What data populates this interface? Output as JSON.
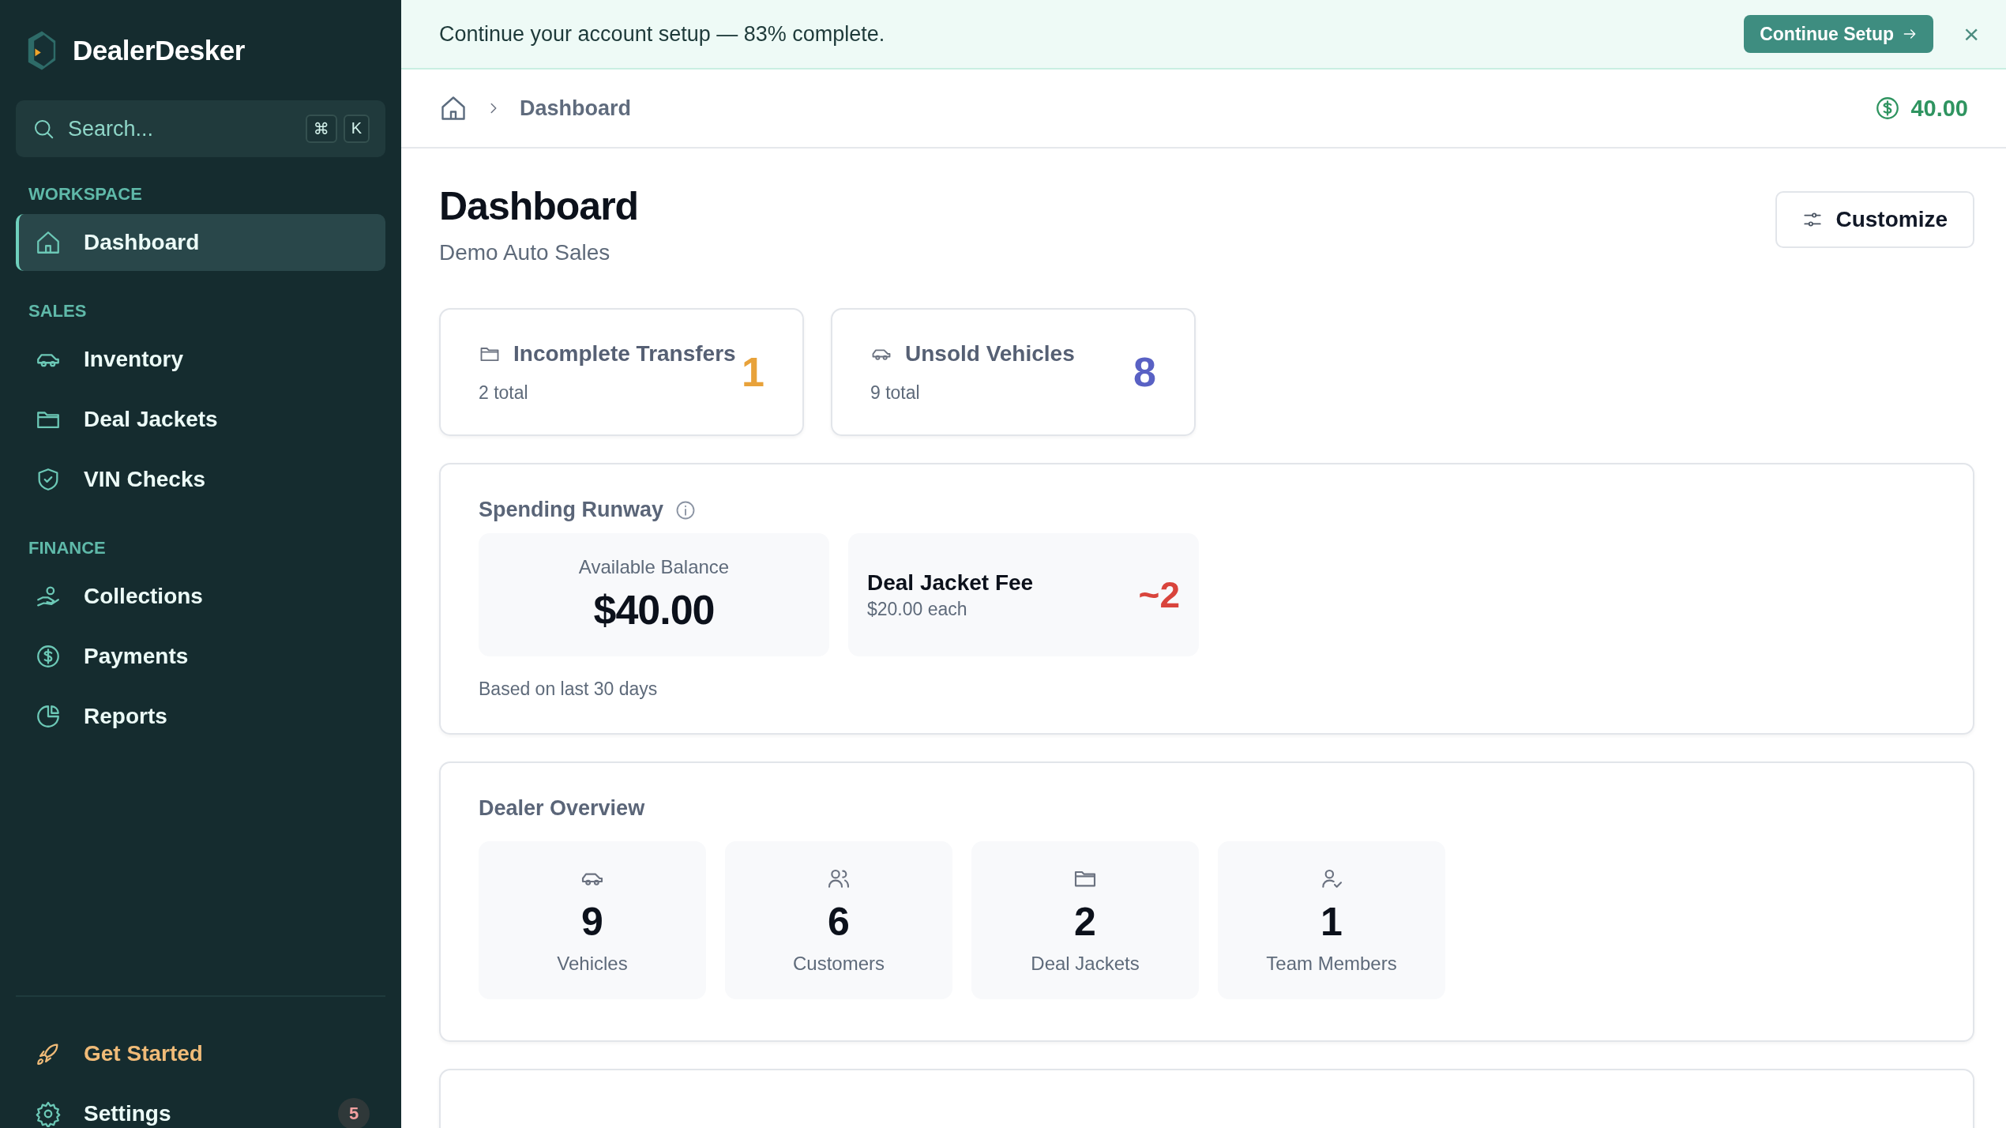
{
  "brand": {
    "name": "DealerDesker"
  },
  "search": {
    "placeholder": "Search...",
    "keys": [
      "⌘",
      "K"
    ]
  },
  "sidebar": {
    "sections": [
      {
        "label": "WORKSPACE",
        "items": [
          {
            "label": "Dashboard",
            "selected": true
          }
        ]
      },
      {
        "label": "SALES",
        "items": [
          {
            "label": "Inventory",
            "selected": false
          },
          {
            "label": "Deal Jackets",
            "selected": false
          },
          {
            "label": "VIN Checks",
            "selected": false
          }
        ]
      },
      {
        "label": "FINANCE",
        "items": [
          {
            "label": "Collections",
            "selected": false
          },
          {
            "label": "Payments",
            "selected": false
          },
          {
            "label": "Reports",
            "selected": false
          }
        ]
      }
    ],
    "footer_items": [
      {
        "label": "Get Started",
        "kind": "accent"
      },
      {
        "label": "Settings",
        "kind": "normal",
        "badge": "5"
      }
    ]
  },
  "banner": {
    "text": "Continue your account setup — 83% complete.",
    "button": "Continue Setup",
    "close": "×"
  },
  "breadcrumb": {
    "items": [
      "Dashboard"
    ],
    "balance": "40.00"
  },
  "header": {
    "title": "Dashboard",
    "subtitle": "Demo Auto Sales",
    "button": "Customize"
  },
  "metrics": [
    {
      "title": "Incomplete Transfers",
      "sub": "2 total",
      "value": "1",
      "color": "#e8a23a"
    },
    {
      "title": "Unsold Vehicles",
      "sub": "9 total",
      "value": "8",
      "color": "#5961c4"
    }
  ],
  "runway": {
    "title": "Spending Runway",
    "balance_label": "Available Balance",
    "balance": "$40.00",
    "fee_title": "Deal Jacket Fee",
    "fee_sub": "$20.00 each",
    "fee_count": "~2",
    "note": "Based on last 30 days"
  },
  "overview": {
    "title": "Dealer Overview",
    "stats": [
      {
        "value": "9",
        "label": "Vehicles"
      },
      {
        "value": "6",
        "label": "Customers"
      },
      {
        "value": "2",
        "label": "Deal Jackets"
      },
      {
        "value": "1",
        "label": "Team Members"
      }
    ]
  }
}
